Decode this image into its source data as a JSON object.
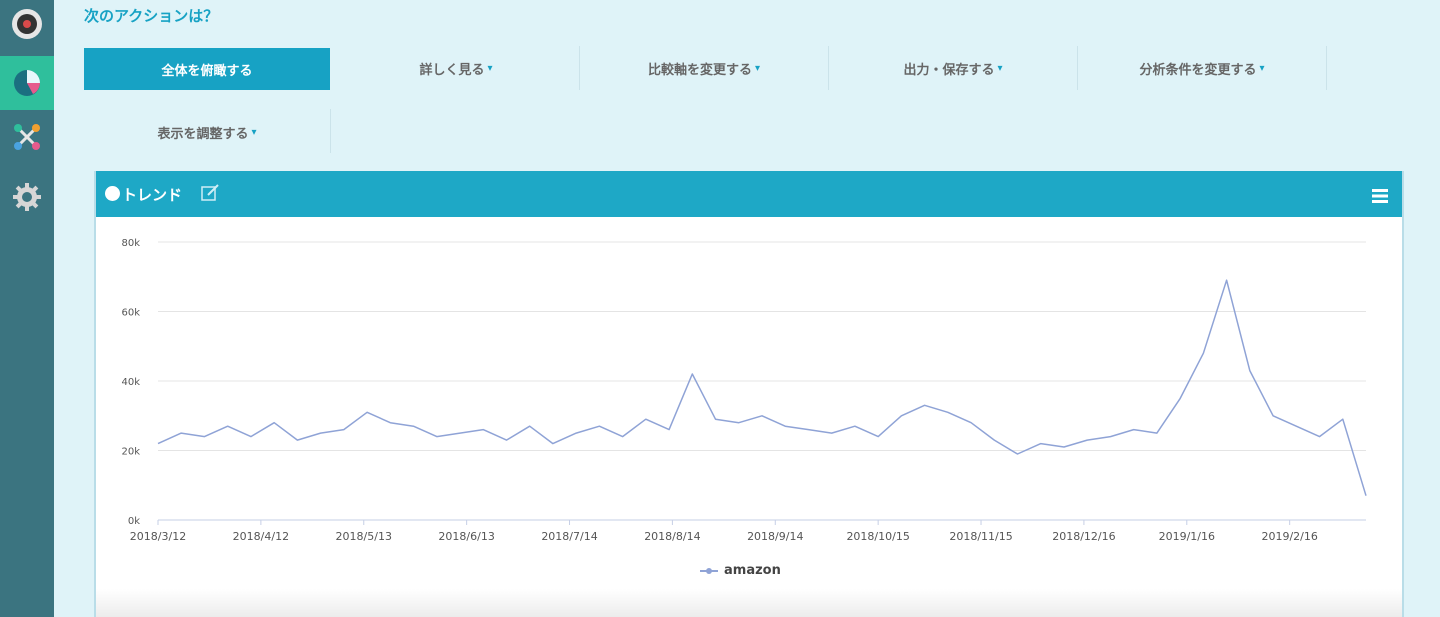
{
  "sidebar": {
    "items": [
      {
        "icon": "dashboard-icon",
        "active": false
      },
      {
        "icon": "pie-chart-icon",
        "active": true
      },
      {
        "icon": "tools-icon",
        "active": false
      },
      {
        "icon": "gear-icon",
        "active": false
      }
    ]
  },
  "header": {
    "next_action_title": "次のアクションは？"
  },
  "actions": [
    {
      "label": "全体を俯瞰する",
      "primary": true
    },
    {
      "label": "詳しく見る"
    },
    {
      "label": "比較軸を変更する"
    },
    {
      "label": "出力・保存する"
    },
    {
      "label": "分析条件を変更する"
    },
    {
      "label": "表示を調整する"
    }
  ],
  "panel": {
    "title": "トレンド"
  },
  "chart_data": {
    "type": "line",
    "title": "トレンド",
    "xlabel": "",
    "ylabel": "",
    "ylim": [
      0,
      80000
    ],
    "y_ticks": [
      "0k",
      "20k",
      "40k",
      "60k",
      "80k"
    ],
    "x_ticks": [
      "2018/3/12",
      "2018/4/12",
      "2018/5/13",
      "2018/6/13",
      "2018/7/14",
      "2018/8/14",
      "2018/9/14",
      "2018/10/15",
      "2018/11/15",
      "2018/12/16",
      "2019/1/16",
      "2019/2/16"
    ],
    "grid": true,
    "legend_position": "bottom",
    "series": [
      {
        "name": "amazon",
        "color": "#8fa3d6",
        "x": [
          "2018/3/12",
          "2018/3/19",
          "2018/3/26",
          "2018/4/2",
          "2018/4/9",
          "2018/4/16",
          "2018/4/23",
          "2018/4/30",
          "2018/5/7",
          "2018/5/14",
          "2018/5/21",
          "2018/5/28",
          "2018/6/4",
          "2018/6/11",
          "2018/6/18",
          "2018/6/25",
          "2018/7/2",
          "2018/7/9",
          "2018/7/16",
          "2018/7/23",
          "2018/7/30",
          "2018/8/6",
          "2018/8/13",
          "2018/8/20",
          "2018/8/27",
          "2018/9/3",
          "2018/9/10",
          "2018/9/17",
          "2018/9/24",
          "2018/10/1",
          "2018/10/8",
          "2018/10/15",
          "2018/10/22",
          "2018/10/29",
          "2018/11/5",
          "2018/11/12",
          "2018/11/19",
          "2018/11/26",
          "2018/12/3",
          "2018/12/10",
          "2018/12/17",
          "2018/12/24",
          "2018/12/31",
          "2019/1/7",
          "2019/1/14",
          "2019/1/21",
          "2019/1/28",
          "2019/2/4",
          "2019/2/11",
          "2019/2/18",
          "2019/2/25",
          "2019/3/4",
          "2019/3/11"
        ],
        "values": [
          22000,
          25000,
          24000,
          27000,
          24000,
          28000,
          23000,
          25000,
          26000,
          31000,
          28000,
          27000,
          24000,
          25000,
          26000,
          23000,
          27000,
          22000,
          25000,
          27000,
          24000,
          29000,
          26000,
          42000,
          29000,
          28000,
          30000,
          27000,
          26000,
          25000,
          27000,
          24000,
          30000,
          33000,
          31000,
          28000,
          23000,
          19000,
          22000,
          21000,
          23000,
          24000,
          26000,
          25000,
          35000,
          48000,
          69000,
          43000,
          30000,
          27000,
          24000,
          29000,
          7000
        ]
      }
    ]
  }
}
